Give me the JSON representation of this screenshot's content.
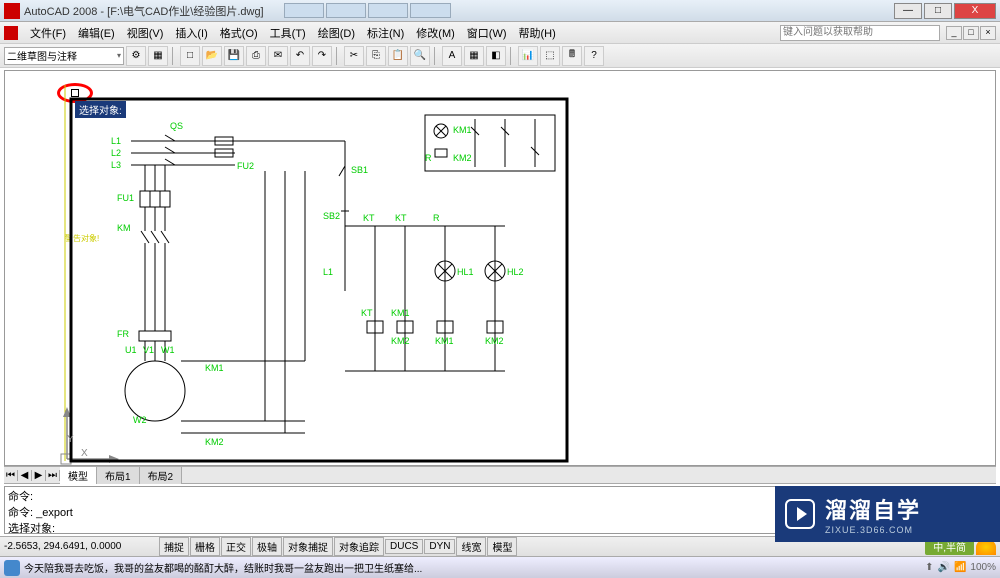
{
  "title": "AutoCAD 2008 - [F:\\电气CAD作业\\经验图片.dwg]",
  "browser_tabs": [
    "",
    "",
    "",
    ""
  ],
  "window_buttons": {
    "min": "—",
    "max": "□",
    "close": "X"
  },
  "menus": [
    "文件(F)",
    "编辑(E)",
    "视图(V)",
    "插入(I)",
    "格式(O)",
    "工具(T)",
    "绘图(D)",
    "标注(N)",
    "修改(M)",
    "窗口(W)",
    "帮助(H)"
  ],
  "help_placeholder": "键入问题以获取帮助",
  "workspace_combo": "二维草图与注释",
  "tooltip": "选择对象:",
  "axis": {
    "x": "X",
    "y": "Y"
  },
  "yellow_text": "警告对象!",
  "circuit": {
    "lines": [
      "L1",
      "L2",
      "L3"
    ],
    "labels": {
      "qs": "QS",
      "fu1": "FU1",
      "fu2": "FU2",
      "km": "KM",
      "km1a": "KM1",
      "km2a": "KM2",
      "fr": "FR",
      "u1": "U1",
      "v1": "V1",
      "w1": "W1",
      "w2": "W2",
      "sb1": "SB1",
      "sb2": "SB2",
      "l1b": "L1",
      "kt": "KT",
      "kta": "KT",
      "ktb": "KT",
      "r": "R",
      "r2": "R",
      "km1b": "KM1",
      "km2b": "KM2",
      "km1c": "KM1",
      "km2c": "KM2",
      "km1d": "KM1",
      "km2d": "KM2",
      "hl1": "HL1",
      "hl2": "HL2"
    }
  },
  "layout_tabs": {
    "model": "模型",
    "l1": "布局1",
    "l2": "布局2"
  },
  "command": {
    "line1": "命令:",
    "line2": "命令: _export",
    "line3": "选择对象:"
  },
  "status": {
    "coords": "-2.5653, 294.6491, 0.0000",
    "toggles": [
      "捕捉",
      "栅格",
      "正交",
      "极轴",
      "对象捕捉",
      "对象追踪",
      "DUCS",
      "DYN",
      "线宽",
      "模型"
    ],
    "half": "中,半简"
  },
  "taskbar_text": "今天陪我哥去吃饭，我哥的盆友都喝的酩酊大醉，结账时我哥一盆友跑出一把卫生纸塞给...",
  "taskbar_zoom": "100%",
  "brand": {
    "main": "溜溜自学",
    "sub": "ZIXUE.3D66.COM"
  }
}
